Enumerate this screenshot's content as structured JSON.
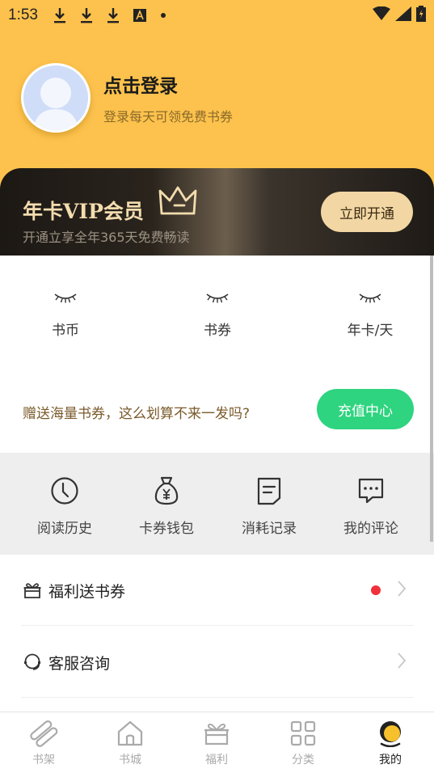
{
  "status_bar": {
    "time": "1:53",
    "icons": [
      "download-icon",
      "download-icon",
      "download-icon",
      "a-icon"
    ]
  },
  "profile": {
    "title": "点击登录",
    "subtitle": "登录每天可领免费书券"
  },
  "vip": {
    "title": "年卡VIP会员",
    "subtitle": "开通立享全年365天免费畅读",
    "button": "立即开通"
  },
  "stats": [
    {
      "label": "书币"
    },
    {
      "label": "书券"
    },
    {
      "label": "年卡/天"
    }
  ],
  "promo": {
    "text": "赠送海量书券，这么划算不来一发吗?",
    "button": "充值中心"
  },
  "quick_actions": [
    {
      "label": "阅读历史",
      "icon": "clock-icon"
    },
    {
      "label": "卡券钱包",
      "icon": "money-bag-icon"
    },
    {
      "label": "消耗记录",
      "icon": "record-icon"
    },
    {
      "label": "我的评论",
      "icon": "comment-icon"
    }
  ],
  "menu": [
    {
      "label": "福利送书券",
      "icon": "gift-icon",
      "badge": true
    },
    {
      "label": "客服咨询",
      "icon": "headset-icon",
      "badge": false
    }
  ],
  "tabs": [
    {
      "label": "书架",
      "icon": "bookshelf-icon"
    },
    {
      "label": "书城",
      "icon": "home-icon"
    },
    {
      "label": "福利",
      "icon": "gift-icon"
    },
    {
      "label": "分类",
      "icon": "grid-icon"
    },
    {
      "label": "我的",
      "icon": "profile-icon",
      "active": true
    }
  ],
  "colors": {
    "header": "#FDC24D",
    "vip_gold": "#F3DCAE",
    "recharge_green": "#2ED47F",
    "badge_red": "#F0303A"
  }
}
